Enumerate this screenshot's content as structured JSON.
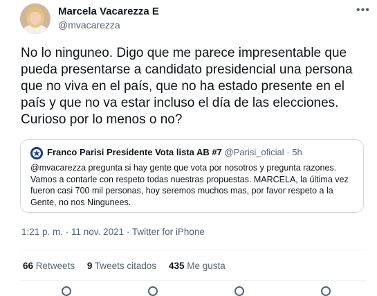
{
  "tweet": {
    "author_name": "Marcela Vacarezza E",
    "author_handle": "@mvacarezza",
    "more_icon": "more-horizontal-icon",
    "text": "No lo ninguneo. Digo que me parece impresentable que pueda presentarse a candidato presidencial una persona que no viva en el país, que no ha estado presente en el país y que no va estar incluso el día de las elecciones. Curioso por lo menos o no?",
    "timestamp": "1:21 p. m. · 11 nov. 2021 · Twitter for iPhone"
  },
  "quoted": {
    "author_name": "Franco Parisi Presidente Vota lista AB #7",
    "author_handle": "@Parisi_oficial",
    "time_ago": "· 5h",
    "text": "@mvacarezza pregunta si hay gente que vota por nosotros y pregunta razones. Vamos a contarle con respeto todas nuestras propuestas. MARCELA, la última vez fueron casi 700 mil personas, hoy seremos muchos mas, por favor respeto a la Gente, no nos Ningunees."
  },
  "stats": {
    "retweets_count": "66",
    "retweets_label": "Retweets",
    "quotes_count": "9",
    "quotes_label": "Tweets citados",
    "likes_count": "435",
    "likes_label": "Me gusta"
  },
  "actions": [
    "reply-icon",
    "retweet-icon",
    "like-icon",
    "share-icon"
  ]
}
